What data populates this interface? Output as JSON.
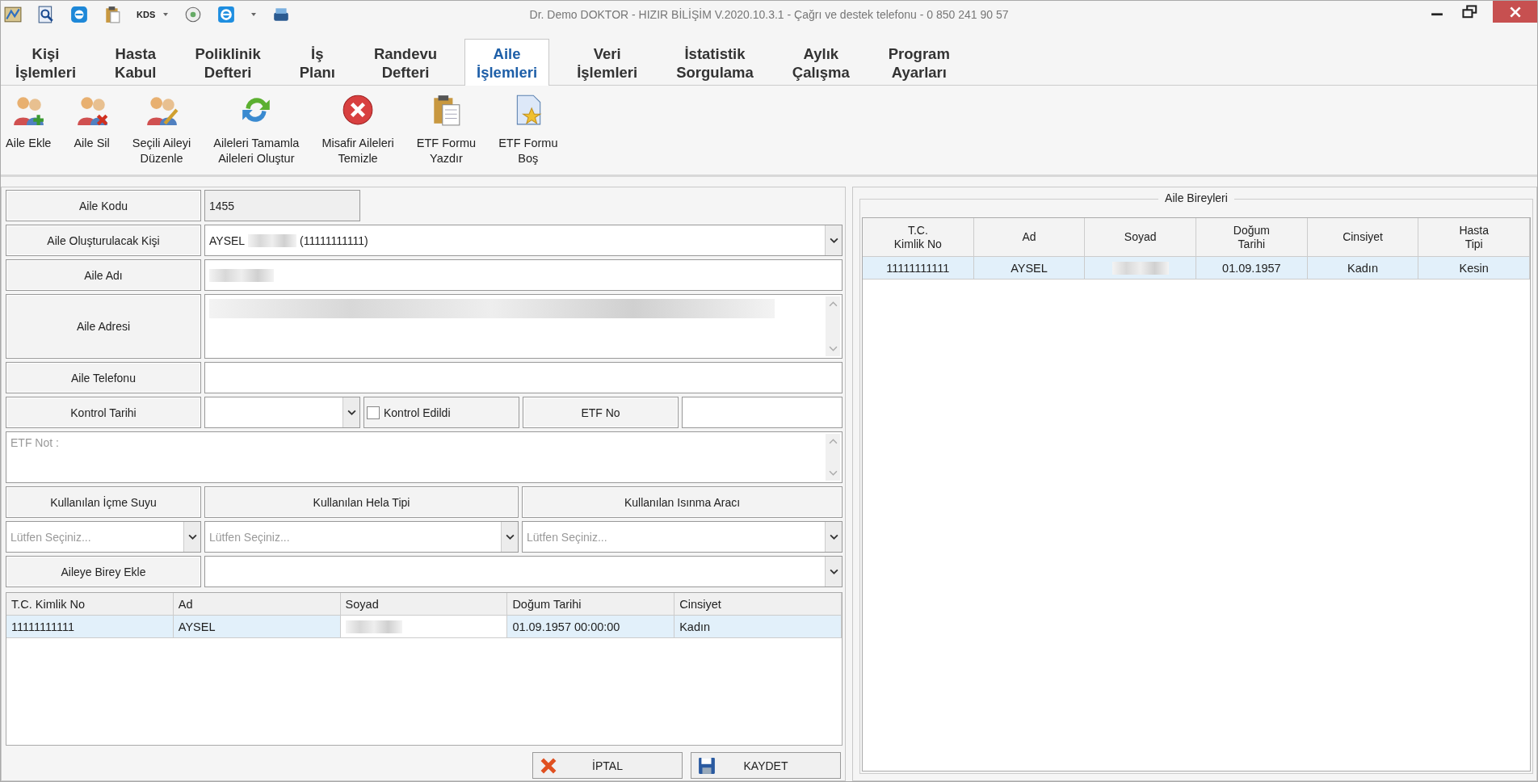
{
  "window": {
    "title": "Dr. Demo DOKTOR - HIZIR BİLİŞİM V.2020.10.3.1 - Çağrı ve destek telefonu - 0 850 241 90 57",
    "quick_access_label": "KDS"
  },
  "tabs": [
    {
      "label": "Kişi\nİşlemleri",
      "selected": false
    },
    {
      "label": "Hasta\nKabul",
      "selected": false
    },
    {
      "label": "Poliklinik\nDefteri",
      "selected": false
    },
    {
      "label": "İş\nPlanı",
      "selected": false
    },
    {
      "label": "Randevu\nDefteri",
      "selected": false
    },
    {
      "label": "Aile\nİşlemleri",
      "selected": true
    },
    {
      "label": "Veri\nİşlemleri",
      "selected": false
    },
    {
      "label": "İstatistik\nSorgulama",
      "selected": false
    },
    {
      "label": "Aylık\nÇalışma",
      "selected": false
    },
    {
      "label": "Program\nAyarları",
      "selected": false
    }
  ],
  "toolbar": [
    {
      "label": "Aile Ekle",
      "kind": "add"
    },
    {
      "label": "Aile Sil",
      "kind": "remove"
    },
    {
      "label": "Seçili Aileyi\nDüzenle",
      "kind": "edit"
    },
    {
      "label": "Aileleri Tamamla\nAileleri Oluştur",
      "kind": "refresh"
    },
    {
      "label": "Misafir Aileleri\nTemizle",
      "kind": "delete"
    },
    {
      "label": "ETF Formu\nYazdır",
      "kind": "print"
    },
    {
      "label": "ETF Formu\nBoş",
      "kind": "blank"
    }
  ],
  "form": {
    "family_code": {
      "label": "Aile Kodu",
      "value": "1455"
    },
    "person": {
      "label": "Aile Oluşturulacak Kişi",
      "value_start": "AYSEL",
      "value_end": "(11111111111)",
      "redacted": true
    },
    "family_name": {
      "label": "Aile Adı",
      "redacted": true
    },
    "address": {
      "label": "Aile Adresi",
      "redacted": true
    },
    "phone": {
      "label": "Aile Telefonu"
    },
    "check_date": {
      "label": "Kontrol Tarihi"
    },
    "checked": {
      "label": "Kontrol Edildi",
      "checked": false
    },
    "etf_no": {
      "label": "ETF No"
    },
    "etf_note": {
      "placeholder": "ETF Not :"
    },
    "selects": [
      {
        "label": "Kullanılan İçme Suyu",
        "placeholder": "Lütfen Seçiniz..."
      },
      {
        "label": "Kullanılan Hela Tipi",
        "placeholder": "Lütfen Seçiniz..."
      },
      {
        "label": "Kullanılan Isınma Aracı",
        "placeholder": "Lütfen Seçiniz..."
      }
    ],
    "add_member": {
      "label": "Aileye Birey Ekle"
    }
  },
  "members_grid": {
    "columns": [
      "T.C. Kimlik No",
      "Ad",
      "Soyad",
      "Doğum Tarihi",
      "Cinsiyet"
    ],
    "rows": [
      {
        "cells": [
          {
            "text": "11111111111"
          },
          {
            "text": "AYSEL"
          },
          {
            "redacted": true
          },
          {
            "text": "01.09.1957 00:00:00"
          },
          {
            "text": "Kadın"
          }
        ],
        "selected": true
      }
    ]
  },
  "buttons": [
    {
      "label": "İPTAL",
      "kind": "cancel"
    },
    {
      "label": "KAYDET",
      "kind": "save"
    }
  ],
  "family_members": {
    "title": "Aile Bireyleri",
    "columns": [
      "T.C.\nKimlik No",
      "Ad",
      "Soyad",
      "Doğum\nTarihi",
      "Cinsiyet",
      "Hasta\nTipi"
    ],
    "rows": [
      {
        "cells": [
          {
            "text": "11111111111"
          },
          {
            "text": "AYSEL"
          },
          {
            "redacted": true
          },
          {
            "text": "01.09.1957"
          },
          {
            "text": "Kadın"
          },
          {
            "text": "Kesin"
          }
        ],
        "selected": true
      }
    ]
  }
}
